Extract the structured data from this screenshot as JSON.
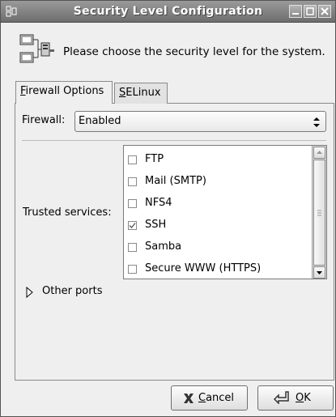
{
  "window": {
    "title": "Security Level Configuration",
    "icons": [
      "app-icon",
      "minimize-icon",
      "maximize-icon",
      "close-icon"
    ]
  },
  "header": {
    "icon": "computer-network-icon",
    "text": "Please choose the security level for the system."
  },
  "tabs": [
    {
      "label_mnemonic": "F",
      "label_rest": "irewall Options",
      "active": true
    },
    {
      "label_mnemonic": "S",
      "label_rest": "ELinux",
      "active": false
    }
  ],
  "firewall": {
    "label": "Firewall:",
    "value": "Enabled"
  },
  "trusted_services": {
    "label": "Trusted services:",
    "items": [
      {
        "label": "FTP",
        "checked": false
      },
      {
        "label": "Mail (SMTP)",
        "checked": false
      },
      {
        "label": "NFS4",
        "checked": false
      },
      {
        "label": "SSH",
        "checked": true
      },
      {
        "label": "Samba",
        "checked": false
      },
      {
        "label": "Secure WWW (HTTPS)",
        "checked": false
      }
    ]
  },
  "other_ports": {
    "label": "Other ports",
    "expanded": false
  },
  "buttons": {
    "cancel_mnemonic": "C",
    "cancel_rest": "ancel",
    "ok_mnemonic": "O",
    "ok_rest": "K"
  },
  "colors": {
    "titlebar": "#7f7f7f",
    "window_bg": "#efefef",
    "list_bg": "#ffffff"
  }
}
